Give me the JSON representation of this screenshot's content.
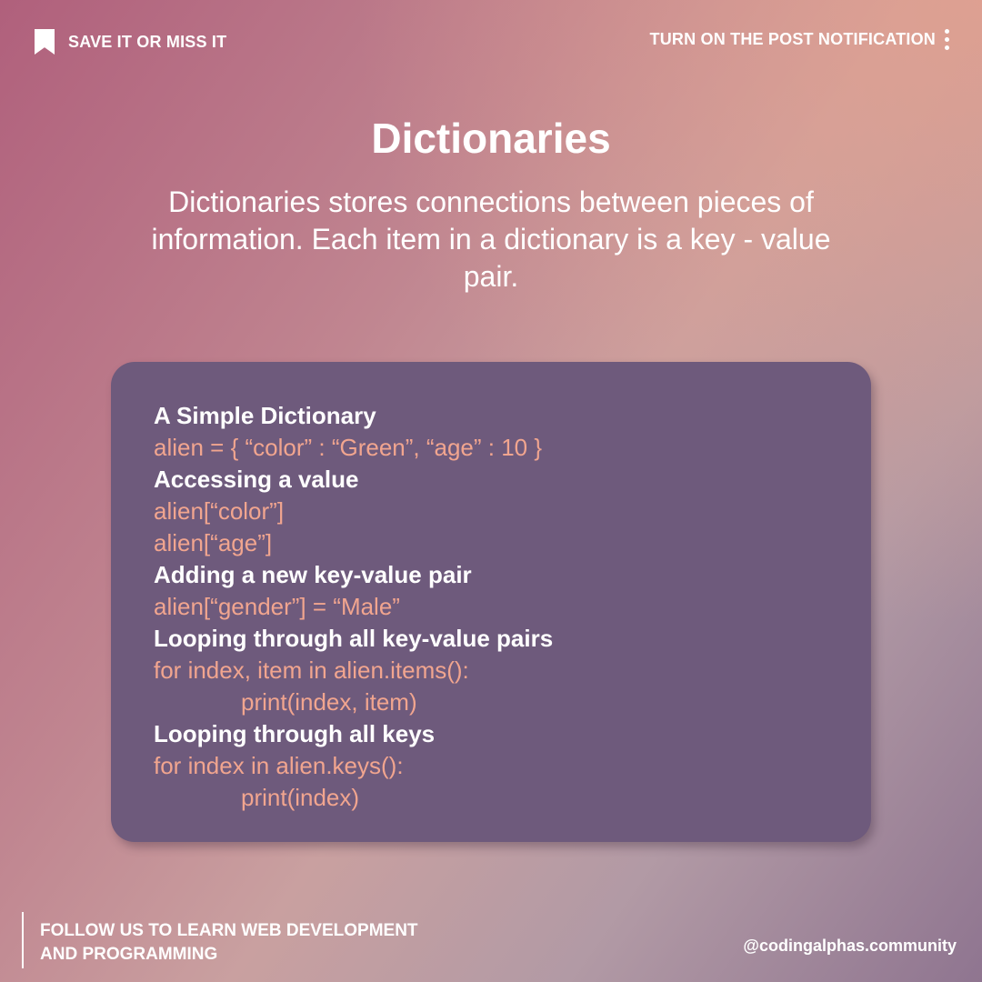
{
  "header": {
    "left_label": "SAVE IT OR MISS IT",
    "left_icon": "bookmark-icon",
    "right_label": "TURN ON THE POST NOTIFICATION",
    "right_icon": "kebab-menu-icon"
  },
  "main": {
    "title": "Dictionaries",
    "description": "Dictionaries stores connections between pieces of information. Each item in a dictionary is a key - value pair."
  },
  "card": {
    "lines": [
      {
        "kind": "head",
        "text": "A Simple Dictionary"
      },
      {
        "kind": "code",
        "text": "alien = { “color” : “Green”, “age” : 10 }"
      },
      {
        "kind": "head",
        "text": "Accessing a value"
      },
      {
        "kind": "code",
        "text": "alien[“color”]"
      },
      {
        "kind": "code",
        "text": "alien[“age”]"
      },
      {
        "kind": "head",
        "text": "Adding a new key-value pair"
      },
      {
        "kind": "code",
        "text": "alien[“gender”] = “Male”"
      },
      {
        "kind": "head",
        "text": "Looping through all key-value pairs"
      },
      {
        "kind": "code",
        "text": "for index, item in alien.items():"
      },
      {
        "kind": "code",
        "text": "print(index, item)"
      },
      {
        "kind": "head",
        "text": "Looping through all keys"
      },
      {
        "kind": "code",
        "text": "for index in alien.keys():"
      },
      {
        "kind": "code",
        "text": "print(index)"
      }
    ]
  },
  "footer": {
    "follow_line1": "FOLLOW US TO LEARN WEB DEVELOPMENT",
    "follow_line2": "AND PROGRAMMING",
    "handle": "@codingalphas.community"
  },
  "colors": {
    "card_background": "#6e5a7c",
    "code_text": "#f1a58f",
    "heading_text": "#ffffff"
  }
}
